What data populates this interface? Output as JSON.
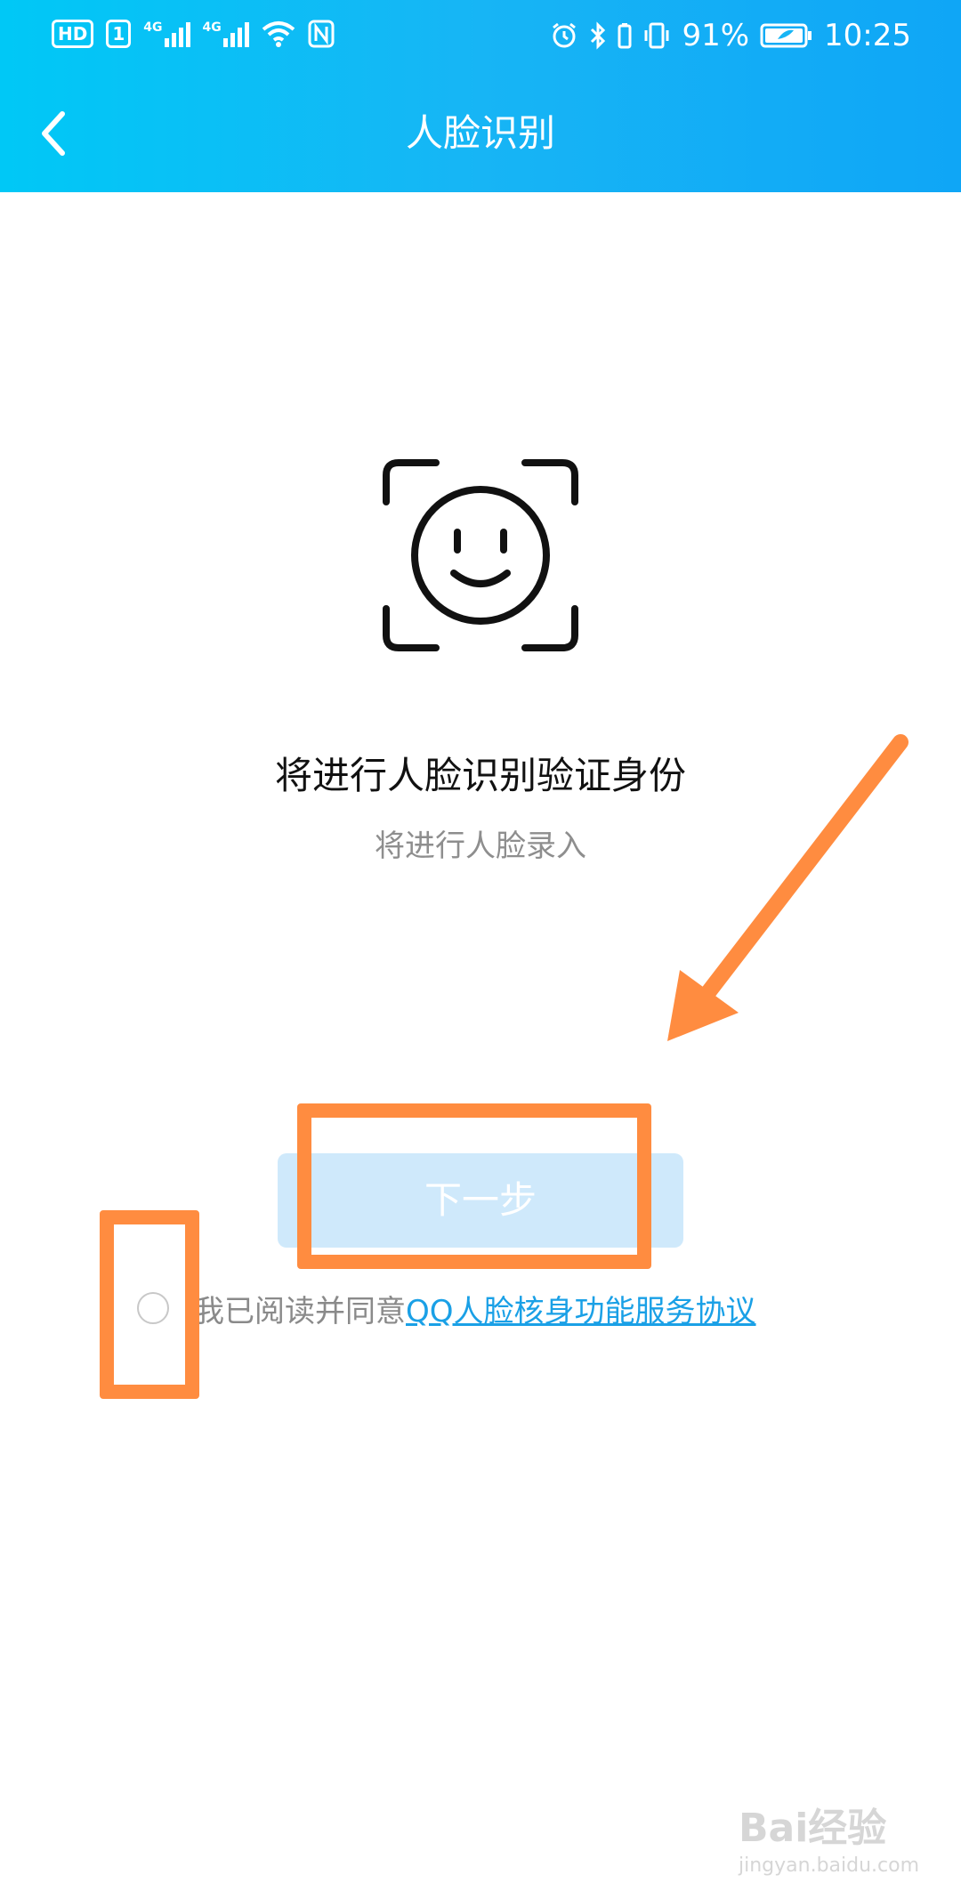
{
  "status_bar": {
    "left_badge_hd": "HD",
    "left_badge_num": "1",
    "net_1": "4G",
    "net_2": "4G",
    "battery_percent": "91%",
    "time": "10:25",
    "icons": [
      "hd-icon",
      "signal-icon",
      "signal-icon",
      "wifi-icon",
      "nfc-icon",
      "alarm-icon",
      "bluetooth-icon",
      "vibrate-icon",
      "battery-icon"
    ]
  },
  "nav": {
    "title": "人脸识别",
    "back_icon": "chevron-left-icon"
  },
  "content": {
    "face_icon": "face-scan-icon",
    "title": "将进行人脸识别验证身份",
    "subtitle": "将进行人脸录入",
    "next_button": "下一步",
    "agree_text": "我已阅读并同意",
    "agree_link": "QQ人脸核身功能服务协议"
  },
  "watermark": {
    "brand": "Bai经验",
    "url": "jingyan.baidu.com"
  },
  "colors": {
    "header_start": "#00c8f6",
    "header_end": "#0fa6f6",
    "button_bg": "#cfe9fb",
    "link": "#1aa0e6",
    "annotation": "#ff8c40"
  }
}
